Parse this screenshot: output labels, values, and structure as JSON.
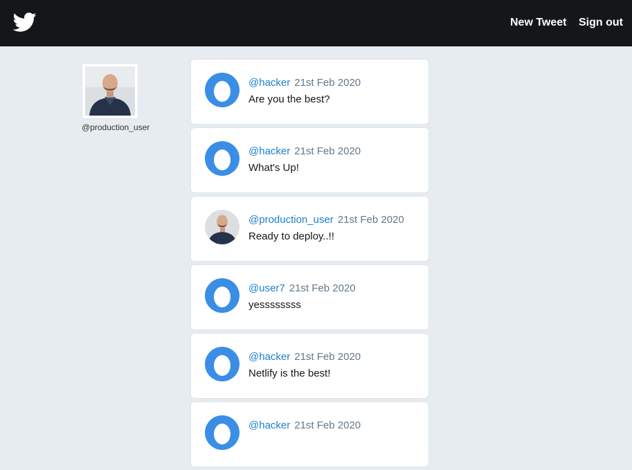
{
  "nav": {
    "new_tweet": "New Tweet",
    "sign_out": "Sign out"
  },
  "profile": {
    "handle": "@production_user"
  },
  "tweets": [
    {
      "user": "@hacker",
      "date": "21st Feb 2020",
      "text": "Are you the best?",
      "avatar": "egg-icon"
    },
    {
      "user": "@hacker",
      "date": "21st Feb 2020",
      "text": "What's Up!",
      "avatar": "egg-icon"
    },
    {
      "user": "@production_user",
      "date": "21st Feb 2020",
      "text": "Ready to deploy..!!",
      "avatar": "photo"
    },
    {
      "user": "@user7",
      "date": "21st Feb 2020",
      "text": "yessssssss",
      "avatar": "egg-icon"
    },
    {
      "user": "@hacker",
      "date": "21st Feb 2020",
      "text": "Netlify is the best!",
      "avatar": "egg-icon"
    },
    {
      "user": "@hacker",
      "date": "21st Feb 2020",
      "text": "",
      "avatar": "egg-icon"
    }
  ],
  "colors": {
    "topbar": "#14171a",
    "background": "#e6ecf0",
    "link": "#1b80d0",
    "egg": "#3a8ee6"
  }
}
